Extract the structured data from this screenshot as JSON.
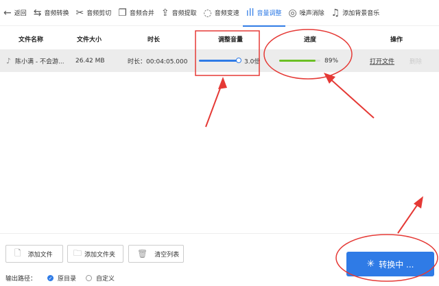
{
  "toolbar": {
    "items": [
      {
        "label": "返回",
        "icon": "back-arrow-icon"
      },
      {
        "label": "音频转换",
        "icon": "convert-icon"
      },
      {
        "label": "音频剪切",
        "icon": "scissors-icon"
      },
      {
        "label": "音频合并",
        "icon": "merge-icon"
      },
      {
        "label": "音频提取",
        "icon": "upload-icon"
      },
      {
        "label": "音频变速",
        "icon": "speed-icon"
      },
      {
        "label": "音量调整",
        "icon": "volume-bars-icon",
        "active": true
      },
      {
        "label": "噪声消除",
        "icon": "noise-icon"
      },
      {
        "label": "添加背景音乐",
        "icon": "music-note-icon"
      }
    ]
  },
  "table": {
    "headers": {
      "name": "文件名称",
      "size": "文件大小",
      "duration": "时长",
      "volume": "调整音量",
      "progress": "进度",
      "actions": "操作"
    },
    "rows": [
      {
        "name": "陈小满 - 不会游...",
        "size": "26.42 MB",
        "duration": "时长：00:04:05.000",
        "volume": "3.0倍",
        "volume_fraction": 1.0,
        "progress": "89%",
        "progress_fraction": 0.89,
        "open": "打开文件",
        "delete": "删除"
      }
    ]
  },
  "buttons": {
    "add_file": "添加文件",
    "add_folder": "添加文件夹",
    "clear": "清空列表",
    "convert": "转换中 ..."
  },
  "output": {
    "label": "输出路径：",
    "opt1": "原目录",
    "opt2": "自定义"
  },
  "colors": {
    "accent": "#2f7be6",
    "progress": "#6cc024",
    "annotation": "#e53935"
  }
}
